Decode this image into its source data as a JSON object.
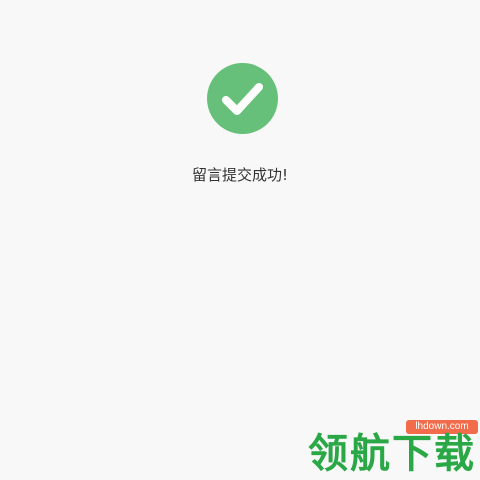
{
  "status": {
    "icon": "check-circle-icon",
    "color": "#66c07a",
    "message": "留言提交成功!"
  },
  "watermark": {
    "url": "lhdown.com",
    "text": "领航下载",
    "color": "#2aa846",
    "url_bg_color": "#f26b4a"
  }
}
